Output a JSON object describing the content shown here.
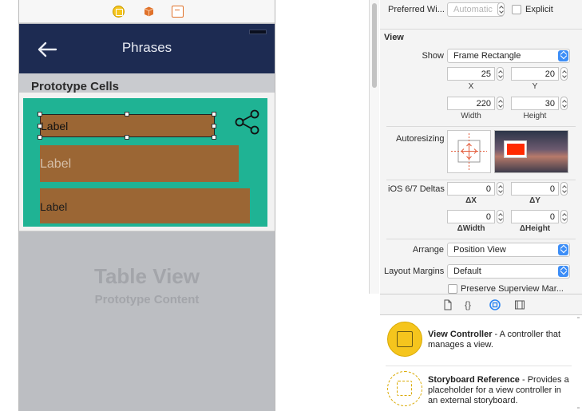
{
  "scene": {
    "nav_title": "Phrases",
    "prototype_cells_title": "Prototype Cells",
    "labels": [
      "Label",
      "Label",
      "Label"
    ],
    "table_placeholder_title": "Table View",
    "table_placeholder_subtitle": "Prototype Content",
    "colors": {
      "navbar": "#1d2b52",
      "cell_content": "#1fb394",
      "label_background": "#9b6634",
      "canvas": "#bcbec2"
    }
  },
  "inspector": {
    "preferred_width": {
      "label": "Preferred Wi...",
      "placeholder": "Automatic",
      "explicit_label": "Explicit"
    },
    "view_section_title": "View",
    "show": {
      "label": "Show",
      "value": "Frame Rectangle"
    },
    "frame": {
      "x": "25",
      "y": "20",
      "width": "220",
      "height": "30",
      "x_caption": "X",
      "y_caption": "Y",
      "width_caption": "Width",
      "height_caption": "Height"
    },
    "autoresizing_label": "Autoresizing",
    "ios_deltas": {
      "label": "iOS 6/7 Deltas",
      "dx": "0",
      "dy": "0",
      "dwidth": "0",
      "dheight": "0",
      "dx_caption": "ΔX",
      "dy_caption": "ΔY",
      "dwidth_caption": "ΔWidth",
      "dheight_caption": "ΔHeight"
    },
    "arrange": {
      "label": "Arrange",
      "value": "Position View"
    },
    "layout_margins": {
      "label": "Layout Margins",
      "value": "Default"
    },
    "preserve_superview": "Preserve Superview Mar..."
  },
  "tabs": [
    "file-icon",
    "braces-icon",
    "object-library-icon",
    "media-library-icon"
  ],
  "library": {
    "items": [
      {
        "title": "View Controller",
        "description": " - A controller that manages a view."
      },
      {
        "title": "Storyboard Reference",
        "description": " - Provides a placeholder for a view controller in an external storyboard."
      }
    ]
  }
}
